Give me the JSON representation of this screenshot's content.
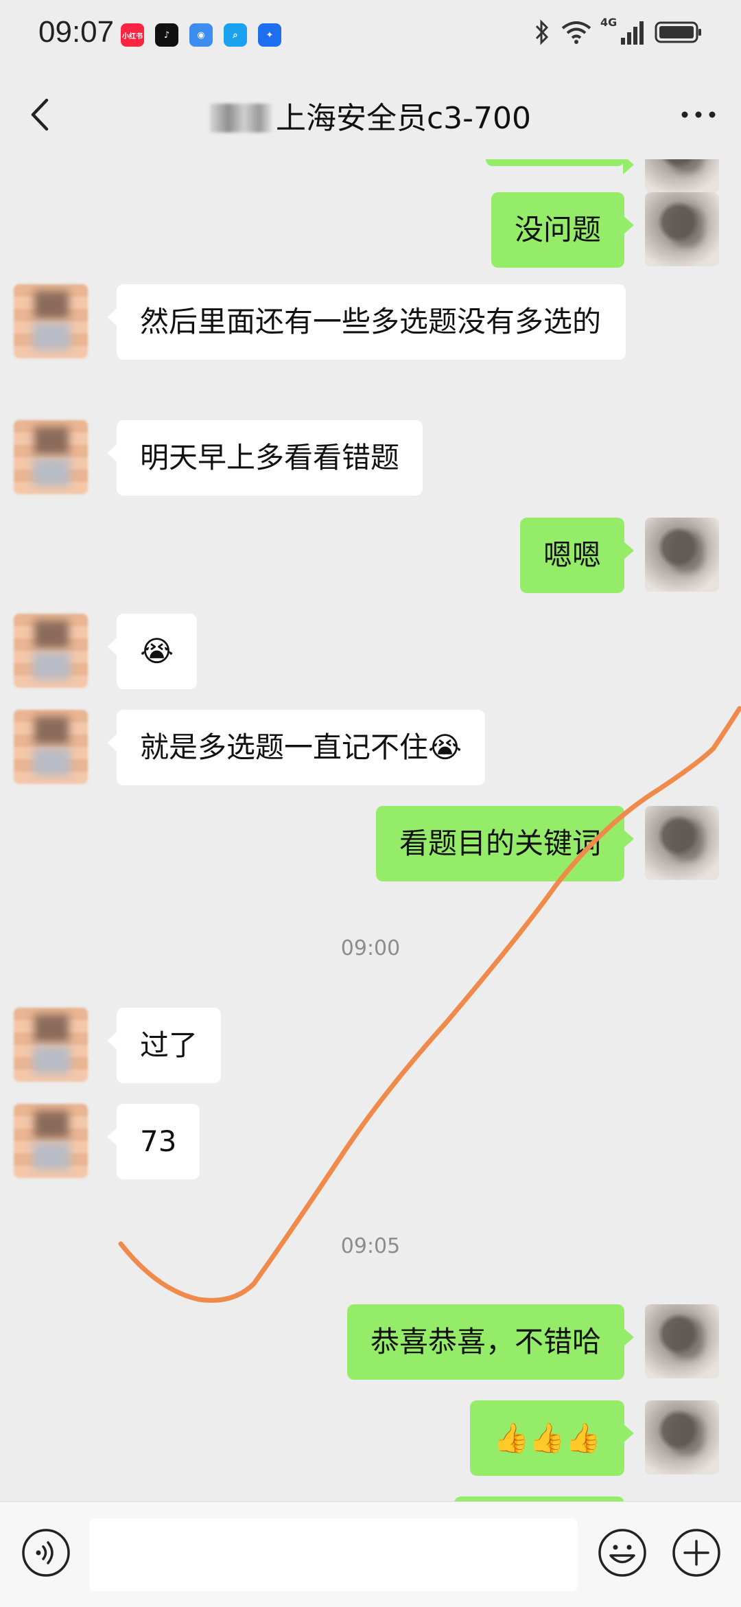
{
  "status_bar": {
    "time": "09:07",
    "network": "4G",
    "app_icons": [
      {
        "name": "xiaohongshu-icon",
        "label": "小红书",
        "color": "#ff2442"
      },
      {
        "name": "tiktok-icon",
        "label": "♪",
        "color": "#111111"
      },
      {
        "name": "browser-icon",
        "label": "◉",
        "color": "#3d8cf0"
      },
      {
        "name": "search-app-icon",
        "label": "⌕",
        "color": "#1aa1f0"
      },
      {
        "name": "bulb-app-icon",
        "label": "✦",
        "color": "#1e6ff0"
      }
    ]
  },
  "header": {
    "title": "上海安全员c3-700"
  },
  "messages": [
    {
      "sender": "me",
      "text": "没问题"
    },
    {
      "sender": "them",
      "text": "然后里面还有一些多选题没有多选的"
    },
    {
      "sender": "them",
      "text": "明天早上多看看错题"
    },
    {
      "sender": "me",
      "text": "嗯嗯"
    },
    {
      "sender": "them",
      "text": "😭"
    },
    {
      "sender": "them",
      "text": "就是多选题一直记不住😭"
    },
    {
      "sender": "me",
      "text": "看题目的关键词"
    },
    {
      "timestamp": "09:00"
    },
    {
      "sender": "them",
      "text": "过了"
    },
    {
      "sender": "them",
      "text": "73"
    },
    {
      "timestamp": "09:05"
    },
    {
      "sender": "me",
      "text": "恭喜恭喜，不错哈"
    },
    {
      "sender": "me",
      "text": "👍👍👍"
    }
  ],
  "input": {
    "placeholder": ""
  },
  "colors": {
    "background": "#ededed",
    "my_bubble": "#95ec69",
    "their_bubble": "#ffffff",
    "annotation_line": "#f08a4b"
  }
}
